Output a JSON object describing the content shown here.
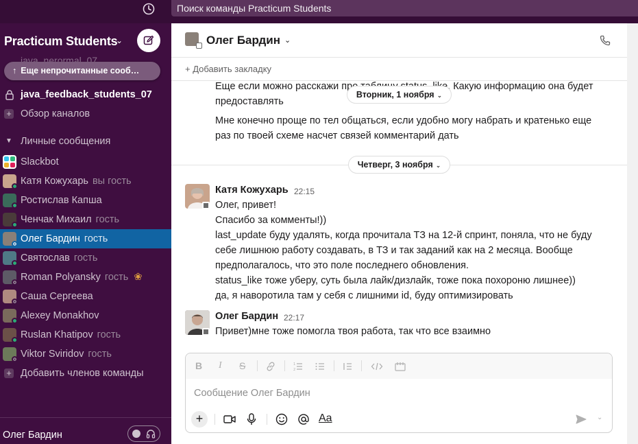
{
  "topbar": {
    "search_text": "Поиск команды Practicum Students"
  },
  "sidebar": {
    "workspace_name": "Practicum Students",
    "faded_channel": "java_nerormal_07",
    "unread_pill": "Еще непрочитанные сооб…",
    "channels": [
      {
        "label": "java_feedback_students_07",
        "icon": "lock-icon",
        "bold": true
      },
      {
        "label": "Обзор каналов",
        "icon": "plus-icon",
        "bold": false
      }
    ],
    "dm_section_title": "Личные сообщения",
    "dms": [
      {
        "name": "Slackbot",
        "tag": ""
      },
      {
        "name": "Катя Кожухарь",
        "tag": "вы  гость"
      },
      {
        "name": "Ростислав Капша",
        "tag": ""
      },
      {
        "name": "Ченчак Михаил",
        "tag": "гость"
      },
      {
        "name": "Олег Бардин",
        "tag": "гость"
      },
      {
        "name": "Святослав",
        "tag": "гость"
      },
      {
        "name": "Roman Polyansky",
        "tag": "гость"
      },
      {
        "name": "Саша Сергеева",
        "tag": ""
      },
      {
        "name": "Alexey Monakhov",
        "tag": ""
      },
      {
        "name": "Ruslan Khatipov",
        "tag": "гость"
      },
      {
        "name": "Viktor Sviridov",
        "tag": "гость"
      }
    ],
    "add_members": "Добавить членов команды",
    "footer_name": "Олег Бардин"
  },
  "channel": {
    "name": "Олег Бардин",
    "add_bookmark": "+ Добавить закладку"
  },
  "messages": {
    "earlier_lines": [
      "Еще если можно расскажи про таблицу status_like. Какую информацию она будет",
      "предоставлять",
      "Мне конечно проще по тел общаться, если удобно могу набрать и кратенько еще",
      "раз по твоей схеме насчет связей комментарий дать"
    ],
    "day1": "Вторник, 1 ноября",
    "day2": "Четверг, 3 ноября",
    "msg1": {
      "sender": "Катя Кожухарь",
      "time": "22:15",
      "lines": [
        "Олег, привет!",
        "Спасибо за комменты!))",
        "last_update буду удалять, когда прочитала ТЗ на 12-й спринт, поняла, что не буду",
        "себе лишнюю работу создавать,  в ТЗ и так заданий как на 2 месяца. Вообще",
        "предполагалось, что это поле последнего обновления.",
        "status_like тоже уберу, суть была лайк/дизлайк, тоже пока похороню лишнее))",
        "да, я наворотила там у себя с лишними id, буду оптимизировать"
      ]
    },
    "msg2": {
      "sender": "Олег Бардин",
      "time": "22:17",
      "lines": [
        "Привет)мне тоже помогла твоя работа, так что все взаимно"
      ]
    }
  },
  "composer": {
    "placeholder": "Сообщение Олег Бардин",
    "format_aa": "Aa"
  },
  "colors": {
    "sidebar_bg": "#3f0e40",
    "active_row": "#1164a3",
    "topbar_bg": "#350d36",
    "online": "#2bac76"
  }
}
